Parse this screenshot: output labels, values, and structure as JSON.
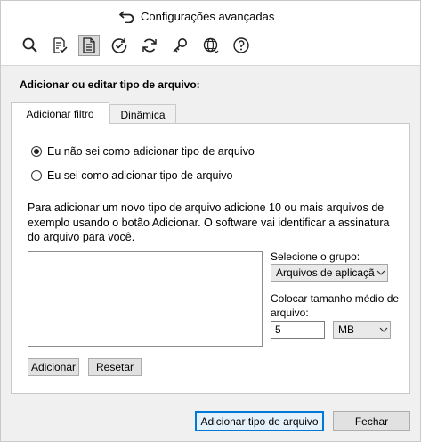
{
  "window": {
    "title": "Configurações avançadas",
    "title_icon": "undo-arrow-icon"
  },
  "toolbar": {
    "tools": [
      "search-icon",
      "document-check-icon",
      "document-list-icon",
      "check-circle-icon",
      "refresh-icon",
      "key-icon",
      "globe-icon",
      "help-icon"
    ],
    "active_tool": "document-list-icon"
  },
  "section": {
    "title": "Adicionar ou editar tipo de arquivo:"
  },
  "tabs": [
    {
      "label": "Adicionar filtro"
    },
    {
      "label": "Dinâmica"
    }
  ],
  "panel": {
    "radio_options": [
      {
        "label": "Eu não sei como adicionar tipo de arquivo",
        "selected": true
      },
      {
        "label": "Eu sei como adicionar tipo de arquivo",
        "selected": false
      }
    ],
    "description": "Para adicionar um novo tipo de arquivo adicione 10 ou mais arquivos de exemplo usando o botão Adicionar. O software vai identificar a assinatura do arquivo para você.",
    "group_label": "Selecione o grupo:",
    "group_value": "Arquivos de aplicaçã",
    "size_label": "Colocar tamanho médio de arquivo:",
    "size_value": "5",
    "size_unit": "MB",
    "add_label": "Adicionar",
    "reset_label": "Resetar"
  },
  "footer": {
    "add_filetype_label": "Adicionar tipo de arquivo",
    "close_label": "Fechar"
  }
}
